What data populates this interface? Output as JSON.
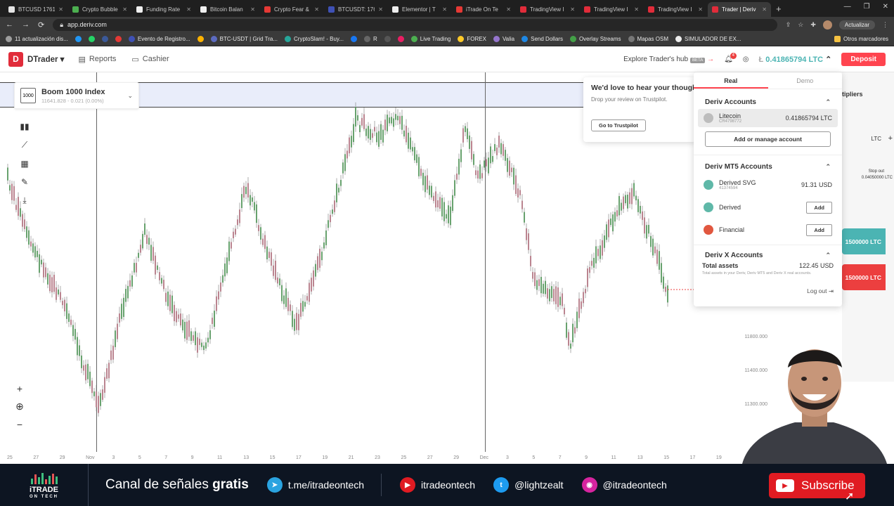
{
  "browser": {
    "tabs": [
      {
        "label": "BTCUSD 1761",
        "color": "#e4e4e4"
      },
      {
        "label": "Crypto Bubble",
        "color": "#4caf50"
      },
      {
        "label": "Funding Rate",
        "color": "#f0f0f0"
      },
      {
        "label": "Bitcoin Balan",
        "color": "#f0f0f0"
      },
      {
        "label": "Crypto Fear &",
        "color": "#e53935"
      },
      {
        "label": "BTCUSDT: 176",
        "color": "#3f51b5"
      },
      {
        "label": "Elementor | T",
        "color": "#eeeeee"
      },
      {
        "label": "iTrade On Te",
        "color": "#e53935"
      },
      {
        "label": "TradingView I",
        "color": "#e12c3a"
      },
      {
        "label": "TradingView I",
        "color": "#e12c3a"
      },
      {
        "label": "TradingView I",
        "color": "#e12c3a"
      },
      {
        "label": "Trader | Deriv",
        "color": "#e12c3a",
        "active": true
      }
    ],
    "url": "app.deriv.com",
    "update_label": "Actualizar",
    "bookmarks": [
      {
        "label": "11 actualización dis...",
        "color": "#9e9e9e"
      },
      {
        "label": "",
        "color": "#2196f3"
      },
      {
        "label": "",
        "color": "#25d366"
      },
      {
        "label": "",
        "color": "#3b5998"
      },
      {
        "label": "",
        "color": "#e53935"
      },
      {
        "label": "Evento de Registro...",
        "color": "#3f51b5"
      },
      {
        "label": "",
        "color": "#ffb300"
      },
      {
        "label": "BTC-USDT | Grid Tra...",
        "color": "#5c6bc0"
      },
      {
        "label": "CryptoSlam! - Buy...",
        "color": "#26a69a"
      },
      {
        "label": "",
        "color": "#1877f2"
      },
      {
        "label": "R",
        "color": "#666"
      },
      {
        "label": "",
        "color": "#555"
      },
      {
        "label": "",
        "color": "#e91e63"
      },
      {
        "label": "Live Trading",
        "color": "#4caf50"
      },
      {
        "label": "FOREX",
        "color": "#ffca28"
      },
      {
        "label": "Valia",
        "color": "#9575cd"
      },
      {
        "label": "Send Dollars",
        "color": "#1e88e5"
      },
      {
        "label": "Overlay Streams",
        "color": "#43a047"
      },
      {
        "label": "Mapas OSM",
        "color": "#777"
      },
      {
        "label": "SIMULADOR DE EX...",
        "color": "#eee"
      }
    ],
    "other_bookmarks": "Otros marcadores"
  },
  "header": {
    "logo_letter": "D",
    "app_name": "DTrader",
    "reports": "Reports",
    "cashier": "Cashier",
    "explore": "Explore Trader's hub",
    "beta": "BETA",
    "notification_count": "4",
    "balance": "0.41865794 LTC",
    "deposit": "Deposit"
  },
  "chart": {
    "symbol": "Boom 1000 Index",
    "symbol_price": "11641.828 - 0.021 (0.00%)",
    "symbol_icon_text": "1000",
    "x_ticks": [
      "25",
      "27",
      "29",
      "Nov",
      "3",
      "5",
      "7",
      "9",
      "11",
      "13",
      "15",
      "17",
      "19",
      "21",
      "23",
      "25",
      "27",
      "29",
      "Dec",
      "3",
      "5",
      "7",
      "9",
      "11",
      "13",
      "15",
      "17",
      "19"
    ],
    "y_ticks": [
      "11800.000",
      "11400.000",
      "11300.000"
    ]
  },
  "review": {
    "title": "We'd love to hear your thoughts",
    "subtitle": "Drop your review on Trustpilot.",
    "button": "Go to Trustpilot"
  },
  "account_menu": {
    "tab_real": "Real",
    "tab_demo": "Demo",
    "deriv_accounts": "Deriv Accounts",
    "litecoin": {
      "name": "Litecoin",
      "id": "CR4798772",
      "amount": "0.41865794 LTC"
    },
    "manage": "Add or manage account",
    "mt5_accounts": "Deriv MT5 Accounts",
    "mt5": [
      {
        "name": "Derived SVG",
        "id": "41374594",
        "amount": "91.31 USD",
        "color": "#5fb8a8"
      },
      {
        "name": "Derived",
        "action": "Add",
        "color": "#5fb8a8"
      },
      {
        "name": "Financial",
        "action": "Add",
        "color": "#e1573f"
      }
    ],
    "x_accounts": "Deriv X Accounts",
    "total_label": "Total assets",
    "total_value": "122.45 USD",
    "total_note": "Total assets in your Deriv, Deriv MT5 and Deriv X real accounts.",
    "logout": "Log out"
  },
  "right_panel": {
    "multipliers": "tipliers",
    "currency": "LTC",
    "stop_out_label": "Stop out",
    "stop_out_value": "0.04050000 LTC",
    "up_value": "1500000 LTC",
    "down_value": "1500000 LTC"
  },
  "promo": {
    "logo": "iTRADE",
    "logo_sub": "ON TECH",
    "canal_prefix": "Canal de señales ",
    "canal_bold": "gratis",
    "telegram": "t.me/itradeontech",
    "youtube": "itradeontech",
    "twitter": "@lightzealt",
    "instagram": "@itradeontech",
    "subscribe": "Subscribe"
  }
}
